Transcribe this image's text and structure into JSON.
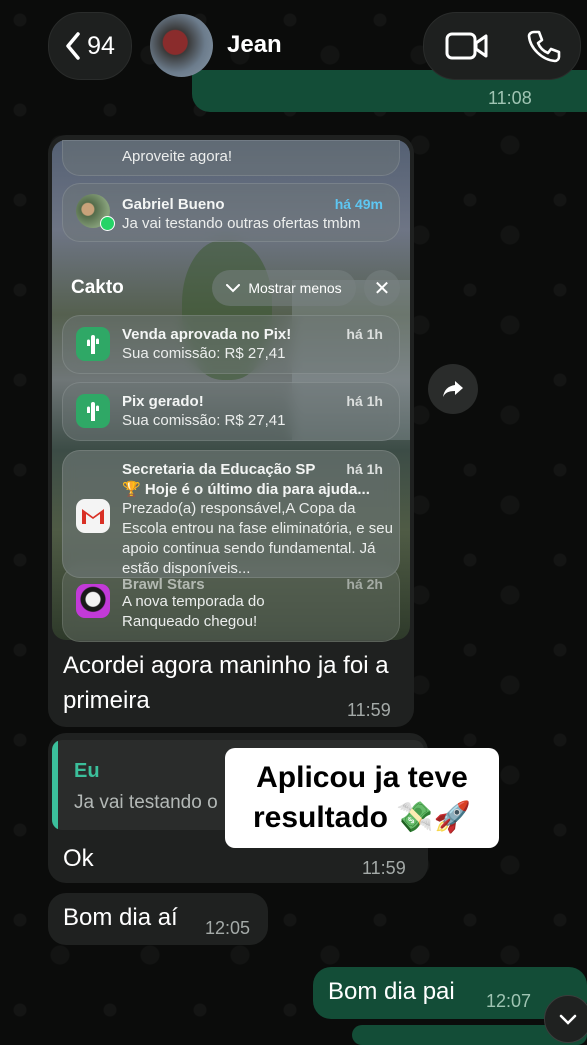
{
  "header": {
    "back_count": "94",
    "contact_name": "Jean"
  },
  "top_partial_message": {
    "time": "11:08"
  },
  "screenshot_message": {
    "notifications_top_partial": "Aproveite agora!",
    "gabriel": {
      "title": "Gabriel Bueno",
      "time": "há 49m",
      "body": "Ja vai testando outras ofertas tmbm"
    },
    "group": {
      "label": "Cakto",
      "show_less": "Mostrar menos"
    },
    "cakto_1": {
      "title": "Venda aprovada no Pix!",
      "time": "há 1h",
      "body": "Sua comissão: R$ 27,41"
    },
    "cakto_2": {
      "title": "Pix gerado!",
      "time": "há 1h",
      "body": "Sua comissão: R$ 27,41"
    },
    "secretaria": {
      "title": "Secretaria da Educação SP",
      "time": "há 1h",
      "subtitle": "🏆 Hoje é o último dia para ajuda...",
      "body": "Prezado(a) responsável,A Copa da Escola entrou na fase eliminatória, e seu apoio continua sendo fundamental. Já estão disponíveis..."
    },
    "brawl": {
      "title": "Brawl Stars",
      "time": "há 2h",
      "body": "A nova temporada do Ranqueado chegou!"
    },
    "caption": "Acordei agora maninho ja foi a primeira",
    "time": "11:59"
  },
  "reply_message": {
    "quote_author": "Eu",
    "quote_text": "Ja vai testando o",
    "text": "Ok",
    "time": "11:59"
  },
  "sticker": {
    "line1": "Aplicou ja teve",
    "line2": "resultado 💸🚀"
  },
  "message_bom_dia_ai": {
    "text": "Bom dia aí",
    "time": "12:05"
  },
  "message_bom_dia_pai": {
    "text": "Bom dia pai",
    "time": "12:07"
  },
  "colors": {
    "outgoing": "#134d37",
    "incoming": "#1f2120",
    "accent": "#3bbf9b"
  }
}
